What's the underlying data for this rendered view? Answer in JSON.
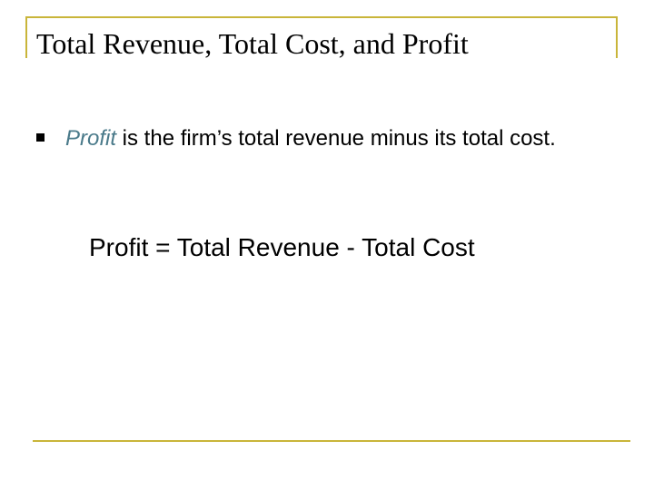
{
  "title": "Total Revenue, Total Cost, and Profit",
  "bullet": {
    "term": "Profit",
    "text": " is the firm’s total revenue minus its total cost."
  },
  "formula": "Profit = Total Revenue - Total Cost",
  "colors": {
    "rule": "#c9b53a",
    "term": "#4a7a8a"
  }
}
